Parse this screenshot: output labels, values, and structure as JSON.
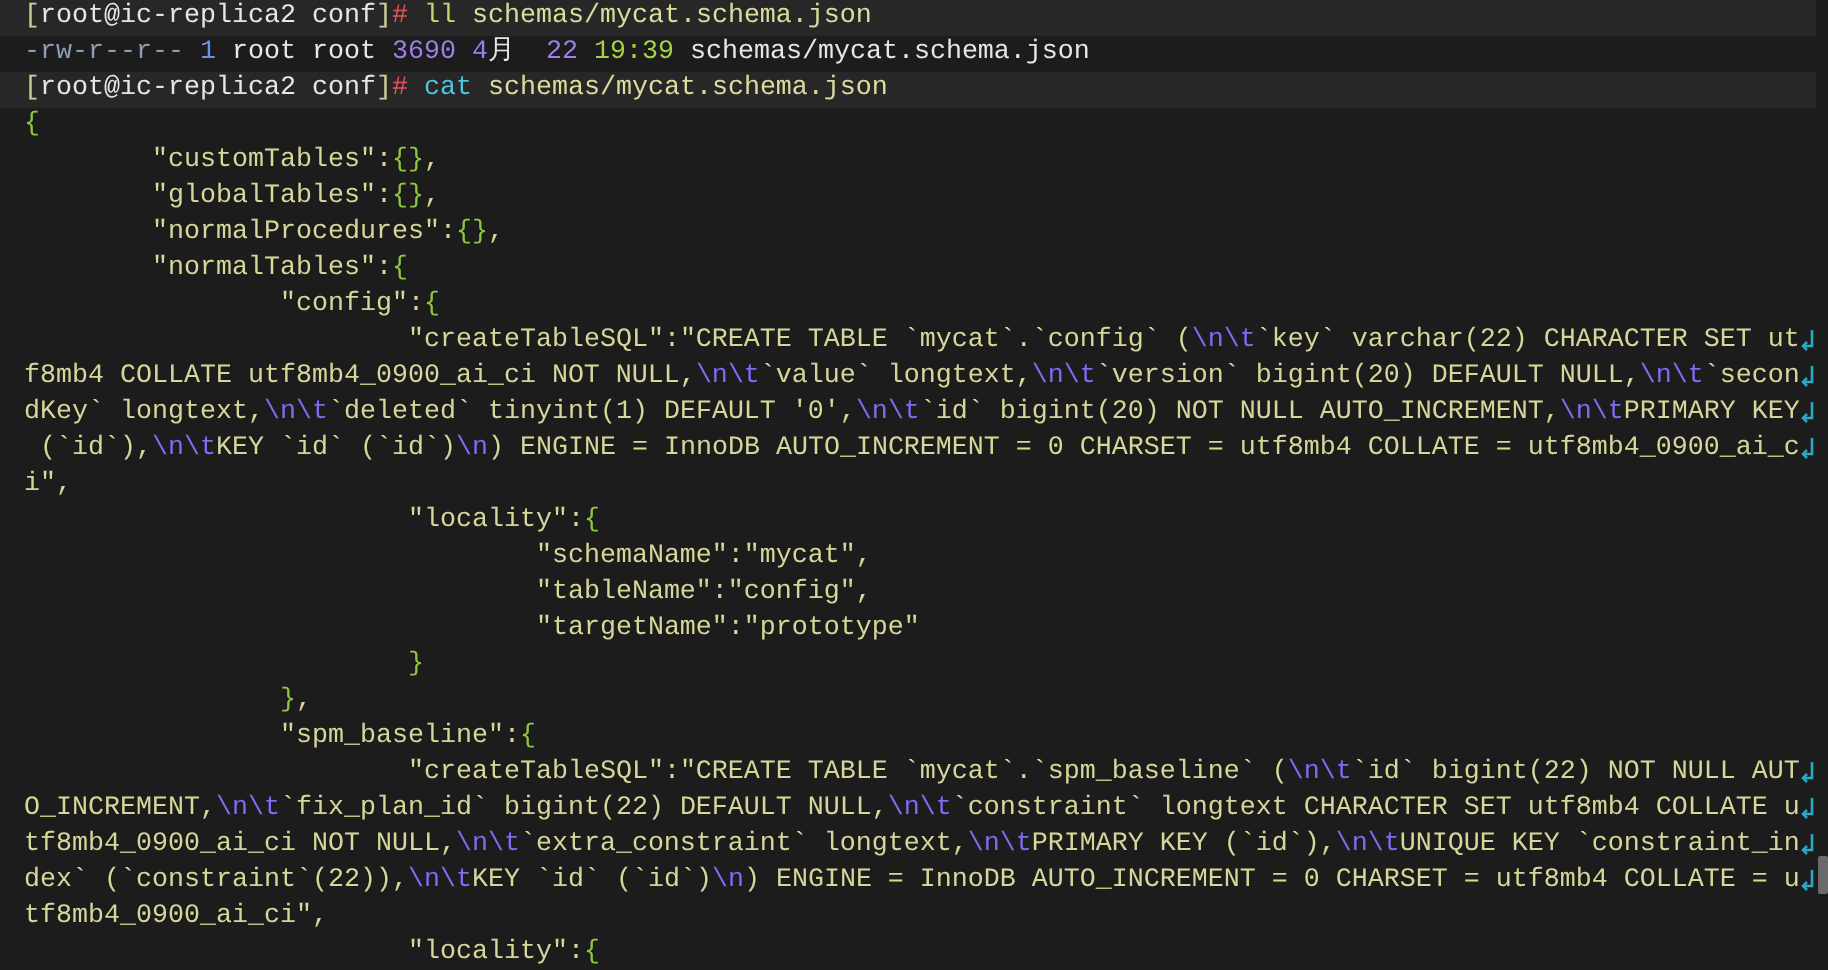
{
  "terminal": {
    "lines": [
      {
        "highlighted": true,
        "wrapped": false,
        "segments": [
          {
            "text": "[",
            "kind": "bracket"
          },
          {
            "text": "root@ic-replica2 conf",
            "kind": "plain"
          },
          {
            "text": "]",
            "kind": "bracket"
          },
          {
            "text": "# ",
            "kind": "sign"
          },
          {
            "text": "ll ",
            "kind": "alias"
          },
          {
            "text": "schemas/mycat.schema.json",
            "kind": "arg"
          }
        ]
      },
      {
        "highlighted": false,
        "wrapped": false,
        "segments": [
          {
            "text": "-rw-r--r-- ",
            "kind": "perm"
          },
          {
            "text": "1 ",
            "kind": "links"
          },
          {
            "text": "root root ",
            "kind": "plain"
          },
          {
            "text": "3690 4",
            "kind": "number"
          },
          {
            "text": "月  ",
            "kind": "plain"
          },
          {
            "text": "22 ",
            "kind": "number"
          },
          {
            "text": "19:39 ",
            "kind": "time"
          },
          {
            "text": "schemas/mycat.schema.json",
            "kind": "plain"
          }
        ]
      },
      {
        "highlighted": true,
        "wrapped": false,
        "segments": [
          {
            "text": "[",
            "kind": "bracket"
          },
          {
            "text": "root@ic-replica2 conf",
            "kind": "plain"
          },
          {
            "text": "]",
            "kind": "bracket"
          },
          {
            "text": "# ",
            "kind": "sign"
          },
          {
            "text": "cat ",
            "kind": "command"
          },
          {
            "text": "schemas/mycat.schema.json",
            "kind": "arg"
          }
        ]
      },
      {
        "highlighted": false,
        "wrapped": false,
        "segments": [
          {
            "text": "{",
            "kind": "json"
          }
        ]
      },
      {
        "highlighted": false,
        "wrapped": false,
        "segments": [
          {
            "text": "\t\"customTables\":{},",
            "kind": "json"
          }
        ]
      },
      {
        "highlighted": false,
        "wrapped": false,
        "segments": [
          {
            "text": "\t\"globalTables\":{},",
            "kind": "json"
          }
        ]
      },
      {
        "highlighted": false,
        "wrapped": false,
        "segments": [
          {
            "text": "\t\"normalProcedures\":{},",
            "kind": "json"
          }
        ]
      },
      {
        "highlighted": false,
        "wrapped": false,
        "segments": [
          {
            "text": "\t\"normalTables\":{",
            "kind": "json"
          }
        ]
      },
      {
        "highlighted": false,
        "wrapped": false,
        "segments": [
          {
            "text": "\t\t\"config\":{",
            "kind": "json"
          }
        ]
      },
      {
        "highlighted": false,
        "wrapped": true,
        "segments": [
          {
            "text": "\t\t\t\"createTableSQL\":\"CREATE TABLE `mycat`.`config` (\\n\\t`key` varchar(22) CHARACTER SET ut",
            "kind": "json"
          }
        ]
      },
      {
        "highlighted": false,
        "wrapped": true,
        "segments": [
          {
            "text": "f8mb4 COLLATE utf8mb4_0900_ai_ci NOT NULL,\\n\\t`value` longtext,\\n\\t`version` bigint(20) DEFAULT NULL,\\n\\t`secon",
            "kind": "json"
          }
        ]
      },
      {
        "highlighted": false,
        "wrapped": true,
        "segments": [
          {
            "text": "dKey` longtext,\\n\\t`deleted` tinyint(1) DEFAULT '0',\\n\\t`id` bigint(20) NOT NULL AUTO_INCREMENT,\\n\\tPRIMARY KEY",
            "kind": "json"
          }
        ]
      },
      {
        "highlighted": false,
        "wrapped": true,
        "segments": [
          {
            "text": " (`id`),\\n\\tKEY `id` (`id`)\\n) ENGINE = InnoDB AUTO_INCREMENT = 0 CHARSET = utf8mb4 COLLATE = utf8mb4_0900_ai_c",
            "kind": "json"
          }
        ]
      },
      {
        "highlighted": false,
        "wrapped": false,
        "segments": [
          {
            "text": "i\",",
            "kind": "json"
          }
        ]
      },
      {
        "highlighted": false,
        "wrapped": false,
        "segments": [
          {
            "text": "\t\t\t\"locality\":{",
            "kind": "json"
          }
        ]
      },
      {
        "highlighted": false,
        "wrapped": false,
        "segments": [
          {
            "text": "\t\t\t\t\"schemaName\":\"mycat\",",
            "kind": "json"
          }
        ]
      },
      {
        "highlighted": false,
        "wrapped": false,
        "segments": [
          {
            "text": "\t\t\t\t\"tableName\":\"config\",",
            "kind": "json"
          }
        ]
      },
      {
        "highlighted": false,
        "wrapped": false,
        "segments": [
          {
            "text": "\t\t\t\t\"targetName\":\"prototype\"",
            "kind": "json"
          }
        ]
      },
      {
        "highlighted": false,
        "wrapped": false,
        "segments": [
          {
            "text": "\t\t\t}",
            "kind": "json"
          }
        ]
      },
      {
        "highlighted": false,
        "wrapped": false,
        "segments": [
          {
            "text": "\t\t},",
            "kind": "json"
          }
        ]
      },
      {
        "highlighted": false,
        "wrapped": false,
        "segments": [
          {
            "text": "\t\t\"spm_baseline\":{",
            "kind": "json"
          }
        ]
      },
      {
        "highlighted": false,
        "wrapped": true,
        "segments": [
          {
            "text": "\t\t\t\"createTableSQL\":\"CREATE TABLE `mycat`.`spm_baseline` (\\n\\t`id` bigint(22) NOT NULL AUT",
            "kind": "json"
          }
        ]
      },
      {
        "highlighted": false,
        "wrapped": true,
        "segments": [
          {
            "text": "O_INCREMENT,\\n\\t`fix_plan_id` bigint(22) DEFAULT NULL,\\n\\t`constraint` longtext CHARACTER SET utf8mb4 COLLATE u",
            "kind": "json"
          }
        ]
      },
      {
        "highlighted": false,
        "wrapped": true,
        "segments": [
          {
            "text": "tf8mb4_0900_ai_ci NOT NULL,\\n\\t`extra_constraint` longtext,\\n\\tPRIMARY KEY (`id`),\\n\\tUNIQUE KEY `constraint_in",
            "kind": "json"
          }
        ]
      },
      {
        "highlighted": false,
        "wrapped": true,
        "segments": [
          {
            "text": "dex` (`constraint`(22)),\\n\\tKEY `id` (`id`)\\n) ENGINE = InnoDB AUTO_INCREMENT = 0 CHARSET = utf8mb4 COLLATE = u",
            "kind": "json"
          }
        ]
      },
      {
        "highlighted": false,
        "wrapped": false,
        "segments": [
          {
            "text": "tf8mb4_0900_ai_ci\",",
            "kind": "json"
          }
        ]
      },
      {
        "highlighted": false,
        "wrapped": false,
        "segments": [
          {
            "text": "\t\t\t\"locality\":{",
            "kind": "json"
          }
        ]
      }
    ]
  }
}
